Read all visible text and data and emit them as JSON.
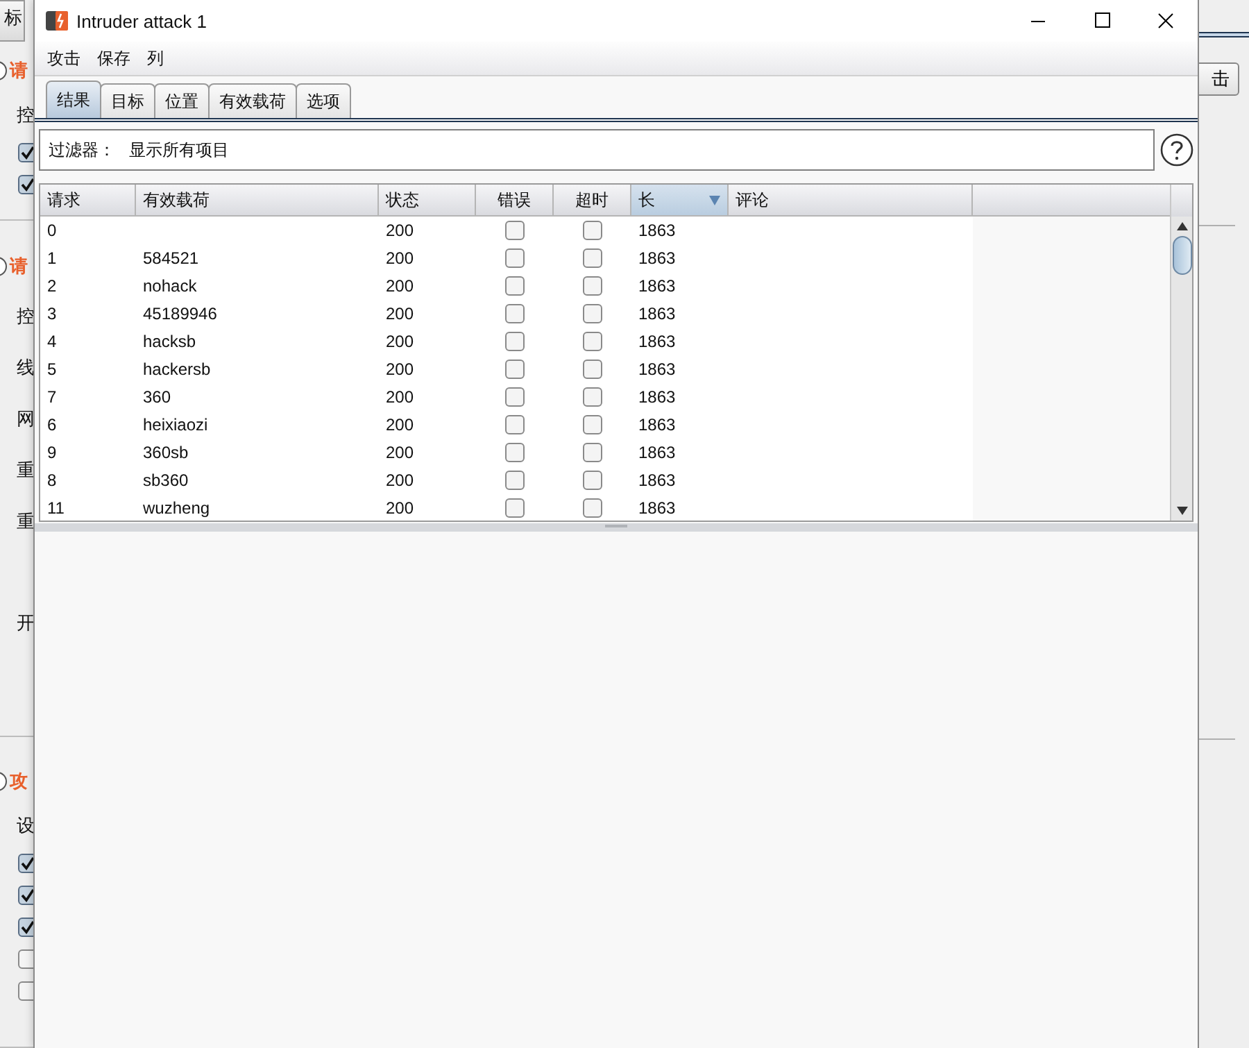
{
  "background_window": {
    "tab": "标",
    "sections": [
      {
        "items": [
          {
            "kind": "heading",
            "text": "请"
          },
          {
            "kind": "label",
            "text": "控"
          },
          {
            "kind": "checkbox",
            "checked": true
          },
          {
            "kind": "checkbox",
            "checked": true
          }
        ]
      },
      {
        "items": [
          {
            "kind": "heading",
            "text": "请"
          },
          {
            "kind": "label",
            "text": "控"
          },
          {
            "kind": "label",
            "text": "线"
          },
          {
            "kind": "label",
            "text": "网"
          },
          {
            "kind": "label",
            "text": "重"
          },
          {
            "kind": "label",
            "text": "重"
          },
          {
            "kind": "spacer"
          },
          {
            "kind": "label",
            "text": "开"
          }
        ]
      },
      {
        "items": [
          {
            "kind": "heading",
            "text": "攻"
          },
          {
            "kind": "label",
            "text": "设"
          },
          {
            "kind": "checkbox",
            "checked": true
          },
          {
            "kind": "checkbox",
            "checked": true
          },
          {
            "kind": "checkbox",
            "checked": true
          },
          {
            "kind": "checkbox",
            "checked": false
          },
          {
            "kind": "checkbox",
            "checked": false
          }
        ]
      }
    ],
    "button": "击"
  },
  "window": {
    "title": "Intruder attack 1"
  },
  "menu": [
    "攻击",
    "保存",
    "列"
  ],
  "tabs": [
    {
      "label": "结果",
      "selected": true
    },
    {
      "label": "目标",
      "selected": false
    },
    {
      "label": "位置",
      "selected": false
    },
    {
      "label": "有效载荷",
      "selected": false
    },
    {
      "label": "选项",
      "selected": false
    }
  ],
  "filter": {
    "label": "过滤器：",
    "value": "显示所有项目"
  },
  "table": {
    "columns": [
      {
        "label": "请求",
        "sorted": false
      },
      {
        "label": "有效载荷",
        "sorted": false
      },
      {
        "label": "状态",
        "sorted": false
      },
      {
        "label": "错误",
        "sorted": false
      },
      {
        "label": "超时",
        "sorted": false
      },
      {
        "label": "长",
        "sorted": true
      },
      {
        "label": "评论",
        "sorted": false
      }
    ],
    "rows": [
      {
        "request": "0",
        "status": "200",
        "error": false,
        "timeout": false,
        "length": "1863"
      },
      {
        "request": "1",
        "payload": "584521",
        "status": "200",
        "error": false,
        "timeout": false,
        "length": "1863"
      },
      {
        "request": "2",
        "payload": "nohack",
        "status": "200",
        "error": false,
        "timeout": false,
        "length": "1863"
      },
      {
        "request": "3",
        "payload": "45189946",
        "status": "200",
        "error": false,
        "timeout": false,
        "length": "1863"
      },
      {
        "request": "4",
        "payload": "hacksb",
        "status": "200",
        "error": false,
        "timeout": false,
        "length": "1863"
      },
      {
        "request": "5",
        "payload": "hackersb",
        "status": "200",
        "error": false,
        "timeout": false,
        "length": "1863"
      },
      {
        "request": "7",
        "payload": "360",
        "status": "200",
        "error": false,
        "timeout": false,
        "length": "1863"
      },
      {
        "request": "6",
        "payload": "heixiaozi",
        "status": "200",
        "error": false,
        "timeout": false,
        "length": "1863"
      },
      {
        "request": "9",
        "payload": "360sb",
        "status": "200",
        "error": false,
        "timeout": false,
        "length": "1863"
      },
      {
        "request": "8",
        "payload": "sb360",
        "status": "200",
        "error": false,
        "timeout": false,
        "length": "1863"
      },
      {
        "request": "11",
        "payload": "wuzheng",
        "status": "200",
        "error": false,
        "timeout": false,
        "length": "1863"
      }
    ]
  }
}
